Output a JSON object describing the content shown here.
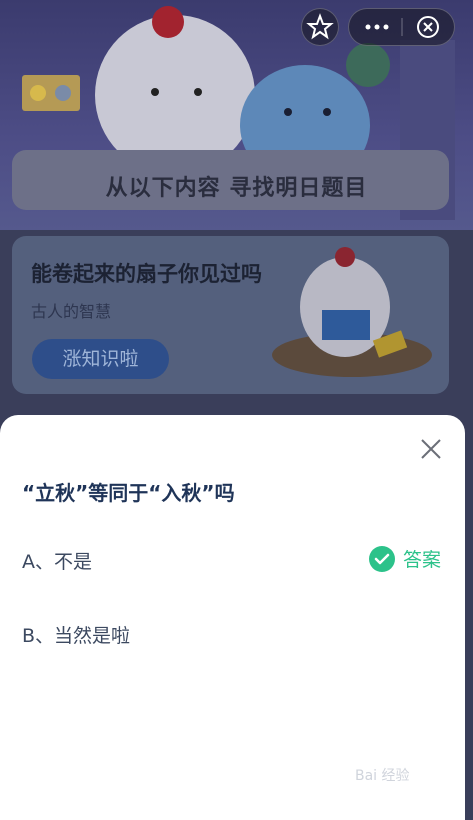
{
  "top_controls": {
    "star_icon": "star-icon",
    "more_icon": "more-icon",
    "close_icon": "close-circle-icon"
  },
  "background": {
    "heading": "从以下内容 寻找明日题目",
    "card": {
      "title": "能卷起来的扇子你见过吗",
      "subtitle": "古人的智慧",
      "button_label": "涨知识啦"
    }
  },
  "sheet": {
    "question": "“立秋”等同于“入秋”吗",
    "options": [
      {
        "label": "A、不是",
        "is_answer": true
      },
      {
        "label": "B、当然是啦",
        "is_answer": false
      }
    ],
    "answer_label": "答案"
  },
  "watermark": {
    "text": "Bai 经验"
  },
  "colors": {
    "accent_green": "#2cc28a",
    "question_text": "#1f3458"
  }
}
